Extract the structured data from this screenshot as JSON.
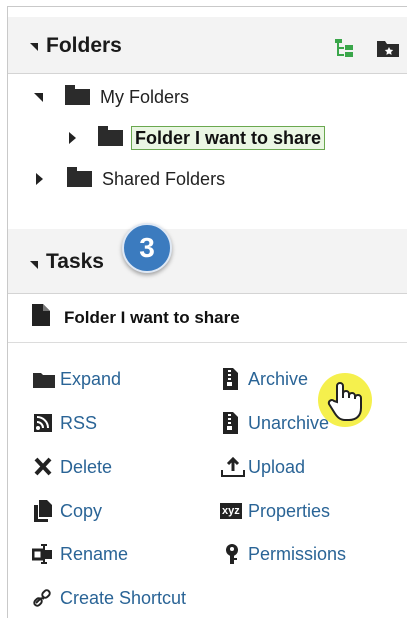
{
  "folders": {
    "title": "Folders",
    "tree": {
      "my_folders": "My Folders",
      "selected_folder": "Folder I want to share",
      "shared_folders": "Shared Folders"
    }
  },
  "tasks": {
    "title": "Tasks",
    "step_badge": "3",
    "selected_item": "Folder I want to share",
    "actions": {
      "expand": "Expand",
      "archive": "Archive",
      "rss": "RSS",
      "unarchive": "Unarchive",
      "delete": "Delete",
      "upload": "Upload",
      "copy": "Copy",
      "properties": "Properties",
      "rename": "Rename",
      "permissions": "Permissions",
      "create_shortcut": "Create Shortcut"
    },
    "xyz_icon_text": "xyz"
  },
  "colors": {
    "link": "#2a6496",
    "accent_green": "#3aa64a",
    "badge_blue": "#3b7bbf",
    "cursor_highlight": "#f4ee3a"
  },
  "icons": [
    "tree-view-icon",
    "new-folder-icon",
    "folder-icon",
    "document-icon",
    "rss-icon",
    "archive-icon",
    "delete-icon",
    "upload-icon",
    "copy-icon",
    "properties-icon",
    "rename-icon",
    "permissions-icon",
    "shortcut-icon",
    "hand-cursor-icon"
  ]
}
